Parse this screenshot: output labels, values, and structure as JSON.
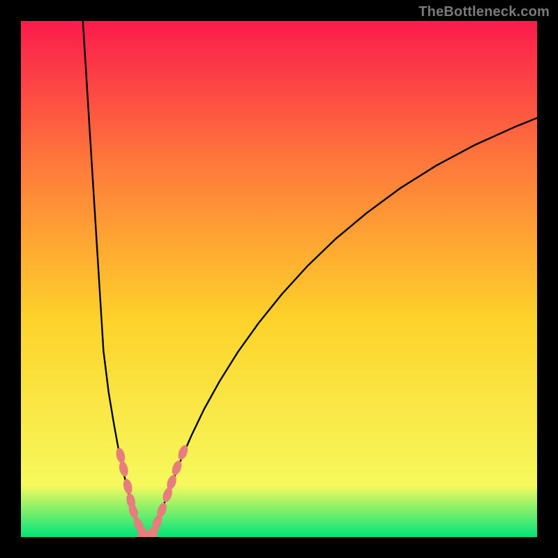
{
  "watermark": "TheBottleneck.com",
  "chart_data": {
    "type": "line",
    "title": "",
    "xlabel": "",
    "ylabel": "",
    "xlim": [
      0,
      100
    ],
    "ylim": [
      0,
      100
    ],
    "grid": false,
    "legend": false,
    "background_gradient": {
      "top": "#fb1b4c",
      "middle_top": "#fe7a3b",
      "middle": "#fdd32a",
      "middle_bottom": "#f6f95d",
      "bottom": "#00e47a"
    },
    "curve_left": {
      "name": "bottleneck-left-branch",
      "x": [
        12,
        12.5,
        13,
        13.5,
        14,
        14.5,
        15,
        15.5,
        16,
        17,
        18,
        19,
        20,
        20.8,
        21.5,
        22.2,
        23,
        23.8
      ],
      "y": [
        100,
        92,
        84,
        76,
        68,
        60,
        52,
        44,
        36,
        28,
        22,
        16.5,
        12,
        8.5,
        5.5,
        3.3,
        1.6,
        0.5
      ]
    },
    "curve_right": {
      "name": "bottleneck-right-branch",
      "x": [
        25.2,
        26,
        27,
        28,
        29.5,
        31,
        33,
        35.5,
        38.5,
        42,
        46,
        50.5,
        55.5,
        61,
        67,
        73.5,
        80.5,
        88,
        96,
        100
      ],
      "y": [
        0.5,
        2,
        4.2,
        7.2,
        11,
        15,
        19.6,
        24.8,
        30.2,
        35.8,
        41.4,
        47,
        52.5,
        57.8,
        62.8,
        67.6,
        72,
        76,
        79.6,
        81.2
      ]
    },
    "trough": {
      "x": 24.5,
      "y": 0
    },
    "beads_left": {
      "name": "left-segment-beads",
      "points": [
        {
          "x": 19.3,
          "y": 15.8
        },
        {
          "x": 19.9,
          "y": 13.2
        },
        {
          "x": 20.7,
          "y": 9.8
        },
        {
          "x": 21.3,
          "y": 7.0
        },
        {
          "x": 21.8,
          "y": 5.0
        },
        {
          "x": 22.8,
          "y": 2.4
        },
        {
          "x": 23.6,
          "y": 1.0
        }
      ]
    },
    "beads_right": {
      "name": "right-segment-beads",
      "points": [
        {
          "x": 25.6,
          "y": 1.0
        },
        {
          "x": 26.4,
          "y": 2.9
        },
        {
          "x": 27.3,
          "y": 5.2
        },
        {
          "x": 28.4,
          "y": 8.2
        },
        {
          "x": 29.2,
          "y": 10.6
        },
        {
          "x": 30.2,
          "y": 13.4
        },
        {
          "x": 31.4,
          "y": 16.4
        }
      ]
    },
    "beads_bottom": {
      "name": "trough-beads",
      "points": [
        {
          "x": 24.0,
          "y": 0.3
        },
        {
          "x": 25.0,
          "y": 0.3
        }
      ]
    },
    "bead_style": {
      "fill": "#e77d7d",
      "rx": 6,
      "ry": 11
    }
  }
}
